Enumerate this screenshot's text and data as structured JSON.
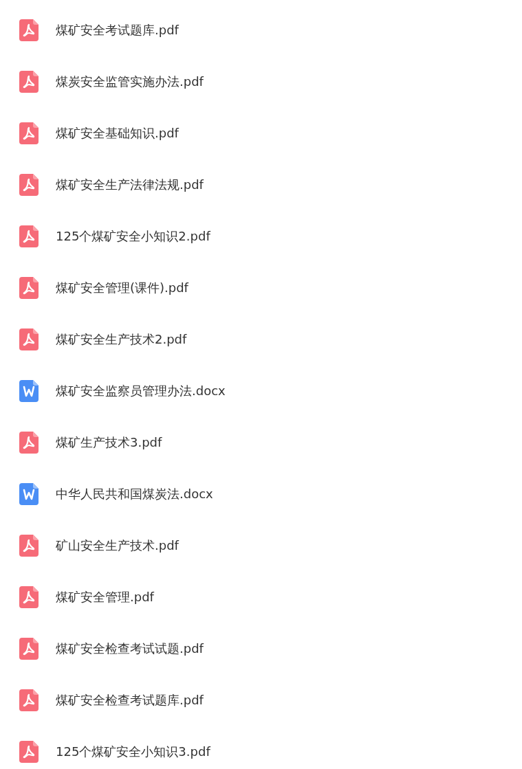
{
  "files": [
    {
      "name": "煤矿安全考试题库.pdf",
      "kind": "pdf"
    },
    {
      "name": "煤炭安全监管实施办法.pdf",
      "kind": "pdf"
    },
    {
      "name": "煤矿安全基础知识.pdf",
      "kind": "pdf"
    },
    {
      "name": "煤矿安全生产法律法规.pdf",
      "kind": "pdf"
    },
    {
      "name": "125个煤矿安全小知识2.pdf",
      "kind": "pdf"
    },
    {
      "name": "煤矿安全管理(课件).pdf",
      "kind": "pdf"
    },
    {
      "name": "煤矿安全生产技术2.pdf",
      "kind": "pdf"
    },
    {
      "name": "煤矿安全监察员管理办法.docx",
      "kind": "docx"
    },
    {
      "name": "煤矿生产技术3.pdf",
      "kind": "pdf"
    },
    {
      "name": "中华人民共和国煤炭法.docx",
      "kind": "docx"
    },
    {
      "name": "矿山安全生产技术.pdf",
      "kind": "pdf"
    },
    {
      "name": "煤矿安全管理.pdf",
      "kind": "pdf"
    },
    {
      "name": "煤矿安全检查考试试题.pdf",
      "kind": "pdf"
    },
    {
      "name": "煤矿安全检查考试题库.pdf",
      "kind": "pdf"
    },
    {
      "name": "125个煤矿安全小知识3.pdf",
      "kind": "pdf"
    }
  ]
}
